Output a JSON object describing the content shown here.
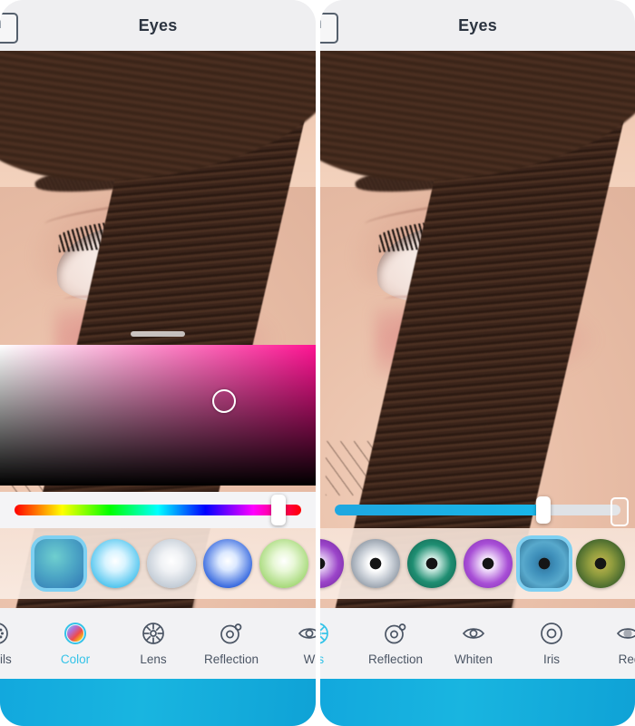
{
  "app": {
    "screen_title": "Eyes",
    "accent_color": "#34c3e8",
    "bottom_bar_color": "#12a8dd",
    "selected_highlight_color": "#7ed0f2"
  },
  "panels": [
    {
      "id": "left",
      "navbar": {
        "title": "Eyes",
        "back_icon": "back-arrow-icon"
      },
      "photo": {
        "subject": "close-up-eye-photo",
        "iris_style": "magenta"
      },
      "color_picker": {
        "visible": true,
        "cursor_x_pct": 71,
        "cursor_y_pct": 40,
        "gradient_hue": "#ff1493",
        "handle": "drag-handle"
      },
      "slider": {
        "type": "hue",
        "value_pct": 92,
        "on_white_background": true
      },
      "swatches": [
        {
          "name": "swatch-lens-teal",
          "selected": true,
          "style": "teal",
          "partial": false
        },
        {
          "name": "swatch-lens-cyan",
          "selected": false,
          "style": "cyan",
          "partial": false
        },
        {
          "name": "swatch-lens-silver",
          "selected": false,
          "style": "silver",
          "partial": false
        },
        {
          "name": "swatch-lens-blue",
          "selected": false,
          "style": "blue",
          "partial": false
        },
        {
          "name": "swatch-lens-green",
          "selected": false,
          "style": "green",
          "partial": false
        }
      ],
      "tools": [
        {
          "name": "tool-details",
          "label": "etails",
          "icon": "details-icon",
          "active": false,
          "clipped": true
        },
        {
          "name": "tool-color",
          "label": "Color",
          "icon": "color-icon",
          "active": true,
          "clipped": false
        },
        {
          "name": "tool-lens",
          "label": "Lens",
          "icon": "lens-icon",
          "active": false,
          "clipped": false
        },
        {
          "name": "tool-reflection",
          "label": "Reflection",
          "icon": "reflection-icon",
          "active": false,
          "clipped": false
        },
        {
          "name": "tool-whiten",
          "label": "W",
          "icon": "whiten-icon",
          "active": false,
          "clipped": true
        }
      ]
    },
    {
      "id": "right",
      "navbar": {
        "title": "Eyes",
        "back_icon": "back-arrow-icon"
      },
      "photo": {
        "subject": "close-up-eye-photo",
        "iris_style": "split-blue-orange"
      },
      "color_picker": {
        "visible": false
      },
      "slider": {
        "type": "intensity",
        "value_pct": 73,
        "on_white_background": false
      },
      "swatches": [
        {
          "name": "swatch-iris-violet",
          "selected": false,
          "style": "violet",
          "partial": true
        },
        {
          "name": "swatch-iris-gray",
          "selected": false,
          "style": "gray",
          "partial": false
        },
        {
          "name": "swatch-iris-teal",
          "selected": false,
          "style": "tealiris",
          "partial": false
        },
        {
          "name": "swatch-iris-purple",
          "selected": false,
          "style": "purple",
          "partial": false
        },
        {
          "name": "swatch-iris-blue",
          "selected": true,
          "style": "blueiris",
          "partial": false
        },
        {
          "name": "swatch-iris-olive",
          "selected": false,
          "style": "olive",
          "partial": false
        }
      ],
      "tools": [
        {
          "name": "tool-lens",
          "label": "ns",
          "icon": "lens-icon",
          "active": true,
          "clipped": true
        },
        {
          "name": "tool-reflection",
          "label": "Reflection",
          "icon": "reflection-icon",
          "active": false,
          "clipped": false
        },
        {
          "name": "tool-whiten",
          "label": "Whiten",
          "icon": "whiten-icon",
          "active": false,
          "clipped": false
        },
        {
          "name": "tool-iris",
          "label": "Iris",
          "icon": "iris-icon",
          "active": false,
          "clipped": false
        },
        {
          "name": "tool-red-eye",
          "label": "Red",
          "icon": "red-eye-icon",
          "active": false,
          "clipped": true
        }
      ]
    }
  ]
}
